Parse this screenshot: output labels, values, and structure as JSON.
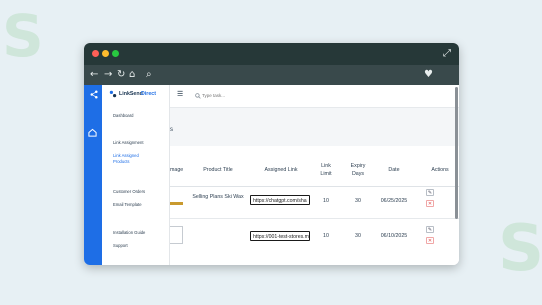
{
  "background": {
    "brand_glyph": "S",
    "brand_color": "#cfe6da"
  },
  "browser": {
    "window_controls": [
      "close-dot",
      "minimize-dot",
      "maximize-dot"
    ],
    "control_colors": [
      "#ff5f57",
      "#febc2e",
      "#28c840"
    ],
    "fullscreen_icon": "⤢",
    "nav_icons": {
      "back": "←",
      "forward": "→",
      "reload": "↻",
      "home": "⌂",
      "search": "⌕",
      "favorite": "♥"
    }
  },
  "app": {
    "brand_name": "LinkSend",
    "brand_suffix": "Direct",
    "accent": "#1e6ee6",
    "search_placeholder": "Type task...",
    "menu_icon": "☰",
    "sidebar": {
      "items": [
        {
          "label": "Dashboard"
        },
        {
          "label": "Link Assignment"
        },
        {
          "label": "Link Assigned Products",
          "active": true
        },
        {
          "label": "Customer Orders"
        },
        {
          "label": "Email Template"
        },
        {
          "label": "Installation Guide"
        },
        {
          "label": "Support"
        }
      ]
    },
    "page_title_fragment": "s",
    "table": {
      "headers": [
        "mage",
        "Product Title",
        "Assigned Link",
        "Link Limit",
        "Expiry Days",
        "Date",
        "Actions"
      ],
      "rows": [
        {
          "product_title": "Selling Plans Ski Wax",
          "assigned_link": "https://chatgpt.com/sha",
          "link_limit": "10",
          "expiry_days": "30",
          "date": "06/25/2025"
        },
        {
          "product_title": "",
          "assigned_link": "https://001-test-stores.m",
          "link_limit": "10",
          "expiry_days": "30",
          "date": "06/10/2025"
        }
      ],
      "edit_icon": "✎",
      "delete_icon": "✕"
    }
  }
}
